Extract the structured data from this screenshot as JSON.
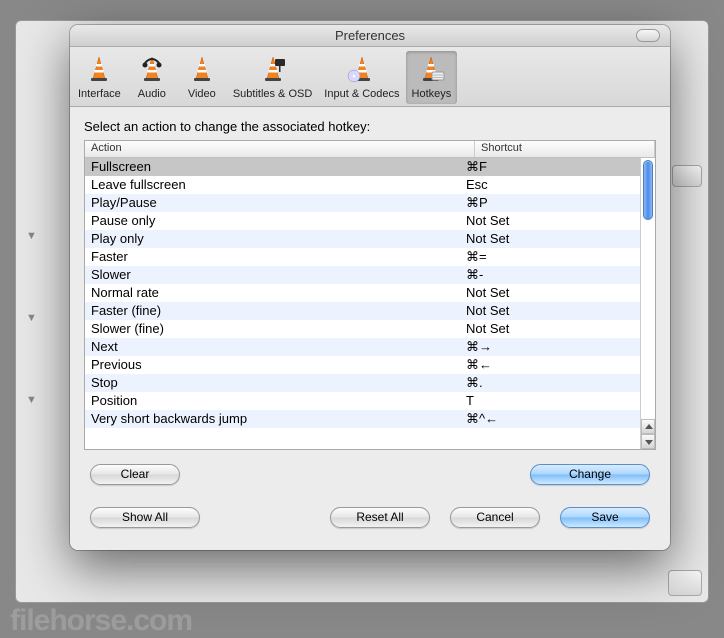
{
  "window_title": "Preferences",
  "toolbar": [
    {
      "label": "Interface",
      "icon": "cone"
    },
    {
      "label": "Audio",
      "icon": "cone-headphones"
    },
    {
      "label": "Video",
      "icon": "cone"
    },
    {
      "label": "Subtitles & OSD",
      "icon": "cone-board"
    },
    {
      "label": "Input & Codecs",
      "icon": "cone-disc"
    },
    {
      "label": "Hotkeys",
      "icon": "cone-keys",
      "selected": true
    }
  ],
  "instruction": "Select an action to change the associated hotkey:",
  "columns": {
    "action": "Action",
    "shortcut": "Shortcut"
  },
  "rows": [
    {
      "action": "Fullscreen",
      "shortcut": "⌘F",
      "selected": true
    },
    {
      "action": "Leave fullscreen",
      "shortcut": "Esc"
    },
    {
      "action": "Play/Pause",
      "shortcut": "⌘P"
    },
    {
      "action": "Pause only",
      "shortcut": "Not Set"
    },
    {
      "action": "Play only",
      "shortcut": "Not Set"
    },
    {
      "action": "Faster",
      "shortcut": "⌘="
    },
    {
      "action": "Slower",
      "shortcut": "⌘-"
    },
    {
      "action": "Normal rate",
      "shortcut": "Not Set"
    },
    {
      "action": "Faster (fine)",
      "shortcut": "Not Set"
    },
    {
      "action": "Slower (fine)",
      "shortcut": "Not Set"
    },
    {
      "action": "Next",
      "shortcut": "⌘→"
    },
    {
      "action": "Previous",
      "shortcut": "⌘←"
    },
    {
      "action": "Stop",
      "shortcut": "⌘."
    },
    {
      "action": "Position",
      "shortcut": "T"
    },
    {
      "action": "Very short backwards jump",
      "shortcut": "⌘^←"
    }
  ],
  "buttons": {
    "clear": "Clear",
    "change": "Change",
    "show_all": "Show All",
    "reset_all": "Reset All",
    "cancel": "Cancel",
    "save": "Save"
  },
  "watermark": "filehorse.com"
}
